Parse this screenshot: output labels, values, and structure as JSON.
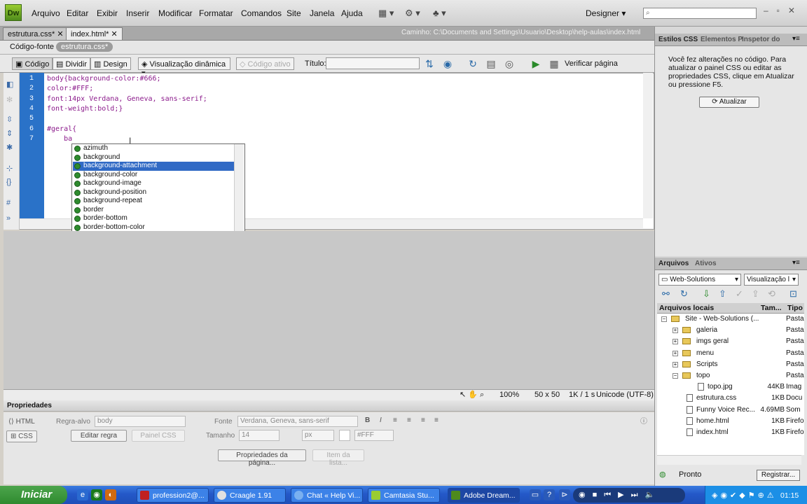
{
  "app": {
    "logo": "Dw",
    "workspace": "Designer"
  },
  "menu": [
    "Arquivo",
    "Editar",
    "Exibir",
    "Inserir",
    "Modificar",
    "Formatar",
    "Comandos",
    "Site",
    "Janela",
    "Ajuda"
  ],
  "tabs": [
    {
      "label": "estrutura.css*"
    },
    {
      "label": "index.html*"
    }
  ],
  "path": "Caminho:  C:\\Documents and Settings\\Usuario\\Desktop\\help-aulas\\index.html",
  "related": {
    "source": "Código-fonte",
    "file": "estrutura.css*"
  },
  "toolbar": {
    "code": "Código",
    "split": "Dividir",
    "design": "Design",
    "live": "Visualização dinâmica",
    "live_code": "Código ativo",
    "title_label": "Título:",
    "title_value": "",
    "verify": "Verificar página"
  },
  "code_lines": [
    {
      "n": "1",
      "text": "body{background-color:#666;"
    },
    {
      "n": "2",
      "text": "color:#FFF;"
    },
    {
      "n": "3",
      "text": "font:14px Verdana, Geneva, sans-serif;"
    },
    {
      "n": "4",
      "text": "font-weight:bold;}"
    },
    {
      "n": "5",
      "text": ""
    },
    {
      "n": "6",
      "text": "#geral{"
    },
    {
      "n": "7",
      "text": "    ba"
    }
  ],
  "autocomplete": {
    "items": [
      "azimuth",
      "background",
      "background-attachment",
      "background-color",
      "background-image",
      "background-position",
      "background-repeat",
      "border",
      "border-bottom",
      "border-bottom-color"
    ],
    "selected": "background-attachment"
  },
  "status": {
    "zoom": "100%",
    "size": "50 x 50",
    "download": "1K / 1 s",
    "encoding": "Unicode (UTF-8)"
  },
  "properties": {
    "title": "Propriedades",
    "html": "HTML",
    "css": "CSS",
    "target_rule_label": "Regra-alvo",
    "target_rule": "body",
    "edit_rule": "Editar regra",
    "css_panel": "Painel CSS",
    "font_label": "Fonte",
    "font": "Verdana, Geneva, sans-serif",
    "size_label": "Tamanho",
    "size": "14",
    "unit": "px",
    "color": "#FFF",
    "page_props": "Propriedades da página...",
    "list_item": "Item da lista..."
  },
  "css_panel": {
    "tabs": [
      "Estilos CSS",
      "Elementos P",
      "Inspetor do"
    ],
    "message": "Você fez alterações no código. Para atualizar o painel CSS ou editar as propriedades CSS, clique em Atualizar ou pressione F5.",
    "refresh": "Atualizar"
  },
  "files_panel": {
    "tabs": [
      "Arquivos",
      "Ativos"
    ],
    "site": "Web-Solutions",
    "view": "Visualização l",
    "headers": {
      "name": "Arquivos locais",
      "size": "Tam...",
      "type": "Tipo"
    },
    "rows": [
      {
        "name": "Site - Web-Solutions (...",
        "size": "",
        "type": "Pasta",
        "indent": 0,
        "kind": "site",
        "pm": "−"
      },
      {
        "name": "galeria",
        "size": "",
        "type": "Pasta",
        "indent": 1,
        "kind": "folder",
        "pm": "+"
      },
      {
        "name": "imgs geral",
        "size": "",
        "type": "Pasta",
        "indent": 1,
        "kind": "folder",
        "pm": "+"
      },
      {
        "name": "menu",
        "size": "",
        "type": "Pasta",
        "indent": 1,
        "kind": "folder",
        "pm": "+"
      },
      {
        "name": "Scripts",
        "size": "",
        "type": "Pasta",
        "indent": 1,
        "kind": "folder",
        "pm": "+"
      },
      {
        "name": "topo",
        "size": "",
        "type": "Pasta",
        "indent": 1,
        "kind": "folder",
        "pm": "−"
      },
      {
        "name": "topo.jpg",
        "size": "44KB",
        "type": "Imag",
        "indent": 2,
        "kind": "file",
        "pm": ""
      },
      {
        "name": "estrutura.css",
        "size": "1KB",
        "type": "Docu",
        "indent": 1,
        "kind": "file",
        "pm": ""
      },
      {
        "name": "Funny Voice Rec...",
        "size": "4.69MB",
        "type": "Som",
        "indent": 1,
        "kind": "file",
        "pm": ""
      },
      {
        "name": "home.html",
        "size": "1KB",
        "type": "Firefo",
        "indent": 1,
        "kind": "file",
        "pm": ""
      },
      {
        "name": "index.html",
        "size": "1KB",
        "type": "Firefo",
        "indent": 1,
        "kind": "file",
        "pm": ""
      }
    ],
    "status": "Pronto",
    "register": "Registrar..."
  },
  "taskbar": {
    "start": "Iniciar",
    "items": [
      {
        "label": "profession2@...",
        "color": "#c02020"
      },
      {
        "label": "Craagle 1.91",
        "color": "#6a6a6a"
      },
      {
        "label": "Chat « Help Vi...",
        "color": "#3a7be0"
      },
      {
        "label": "Camtasia Stu...",
        "color": "#5a9a3a"
      },
      {
        "label": "Adobe Dream...",
        "color": "#2a5a10"
      }
    ],
    "clock": "01:15"
  }
}
